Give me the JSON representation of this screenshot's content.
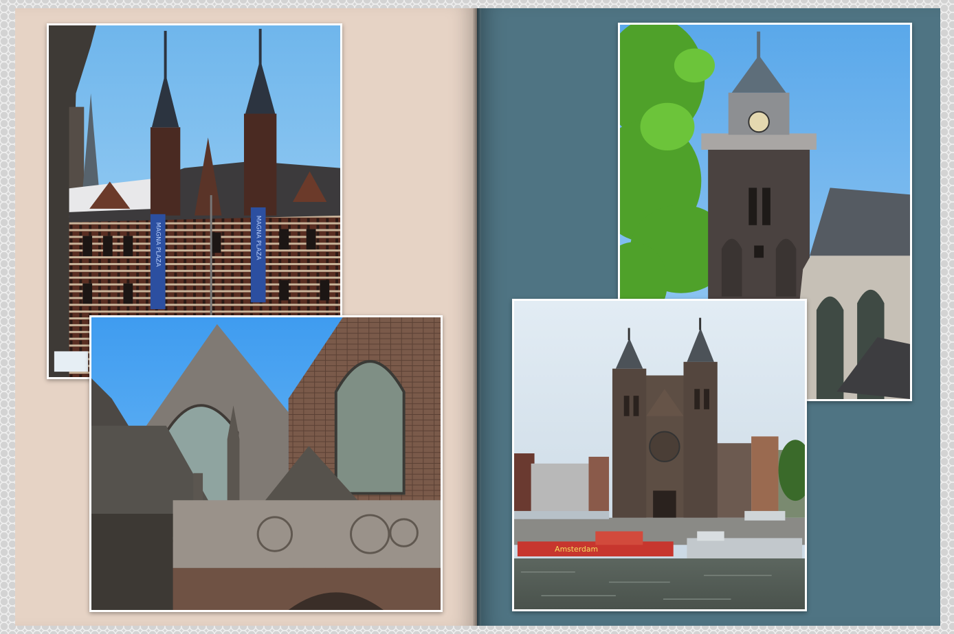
{
  "album": {
    "left_page_color": "#e6d3c5",
    "right_page_color": "#4f7483",
    "border_color": "#d3d3d3"
  },
  "photos": {
    "magna_plaza": {
      "banner_left": "MAGNA PLAZA",
      "banner_right": "MAGNA PLAZA",
      "sign": "Amsterdam"
    },
    "oude_kerk": {},
    "clock_tower": {},
    "st_nicholas": {
      "boat_text": "Amsterdam"
    }
  }
}
